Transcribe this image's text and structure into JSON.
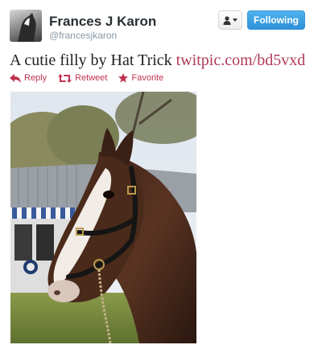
{
  "header": {
    "display_name": "Frances J Karon",
    "handle": "@francesjkaron"
  },
  "controls": {
    "follow_label": "Following",
    "user_menu_icon": "person-icon"
  },
  "tweet": {
    "text": "A cutie filly by Hat Trick",
    "link": "twitpic.com/bd5vxd"
  },
  "actions": [
    {
      "label": "Reply",
      "icon": "reply-icon"
    },
    {
      "label": "Retweet",
      "icon": "retweet-icon"
    },
    {
      "label": "Favorite",
      "icon": "star-icon"
    }
  ],
  "colors": {
    "follow_button": "#2d8fd8",
    "action_accent": "#c0334f",
    "link": "#b23a5a"
  }
}
